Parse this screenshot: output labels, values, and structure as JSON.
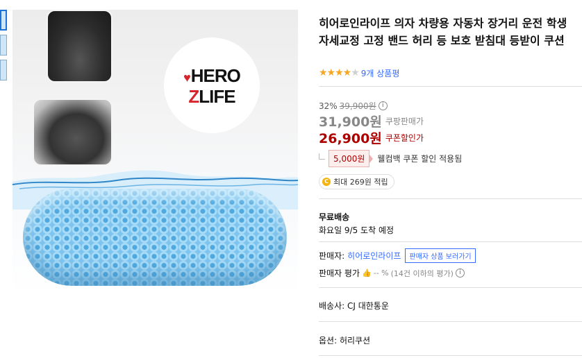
{
  "product": {
    "title": "히어로인라이프 의자 차량용 자동차 장거리 운전 학생 자세교정 고정 밴드 허리 등 보호 받침대 등받이 쿠션",
    "image_logo_line1": "HERO",
    "image_logo_line2": "LIFE",
    "rating_stars": 4.5,
    "review_count_label": "9개 상품평"
  },
  "price": {
    "discount_percent": "32%",
    "original_price": "39,900원",
    "coupang_price": "31,900원",
    "coupang_price_label": "쿠팡판매가",
    "coupon_price": "26,900원",
    "coupon_price_label": "쿠폰할인가",
    "welcome_coupon_amount": "5,000원",
    "welcome_coupon_text": "웰컴백 쿠폰 할인 적용됨",
    "reward_text": "최대 269원 적립",
    "reward_coin_label": "C"
  },
  "shipping": {
    "type": "무료배송",
    "arrival": "화요일 9/5 도착 예정"
  },
  "seller": {
    "label": "판매자:",
    "name": "히어로인라이프",
    "button": "판매자 상품 보러가기",
    "rating_label": "판매자 평가",
    "rating_value": "-- %",
    "rating_note": "(14건 이하의 평가)"
  },
  "delivery": {
    "carrier": "배송사: CJ 대한통운"
  },
  "option": {
    "text": "옵션: 허리쿠션"
  },
  "colors": {
    "link_blue": "#346aff",
    "price_red": "#ae0000",
    "star_orange": "#f5a623"
  }
}
